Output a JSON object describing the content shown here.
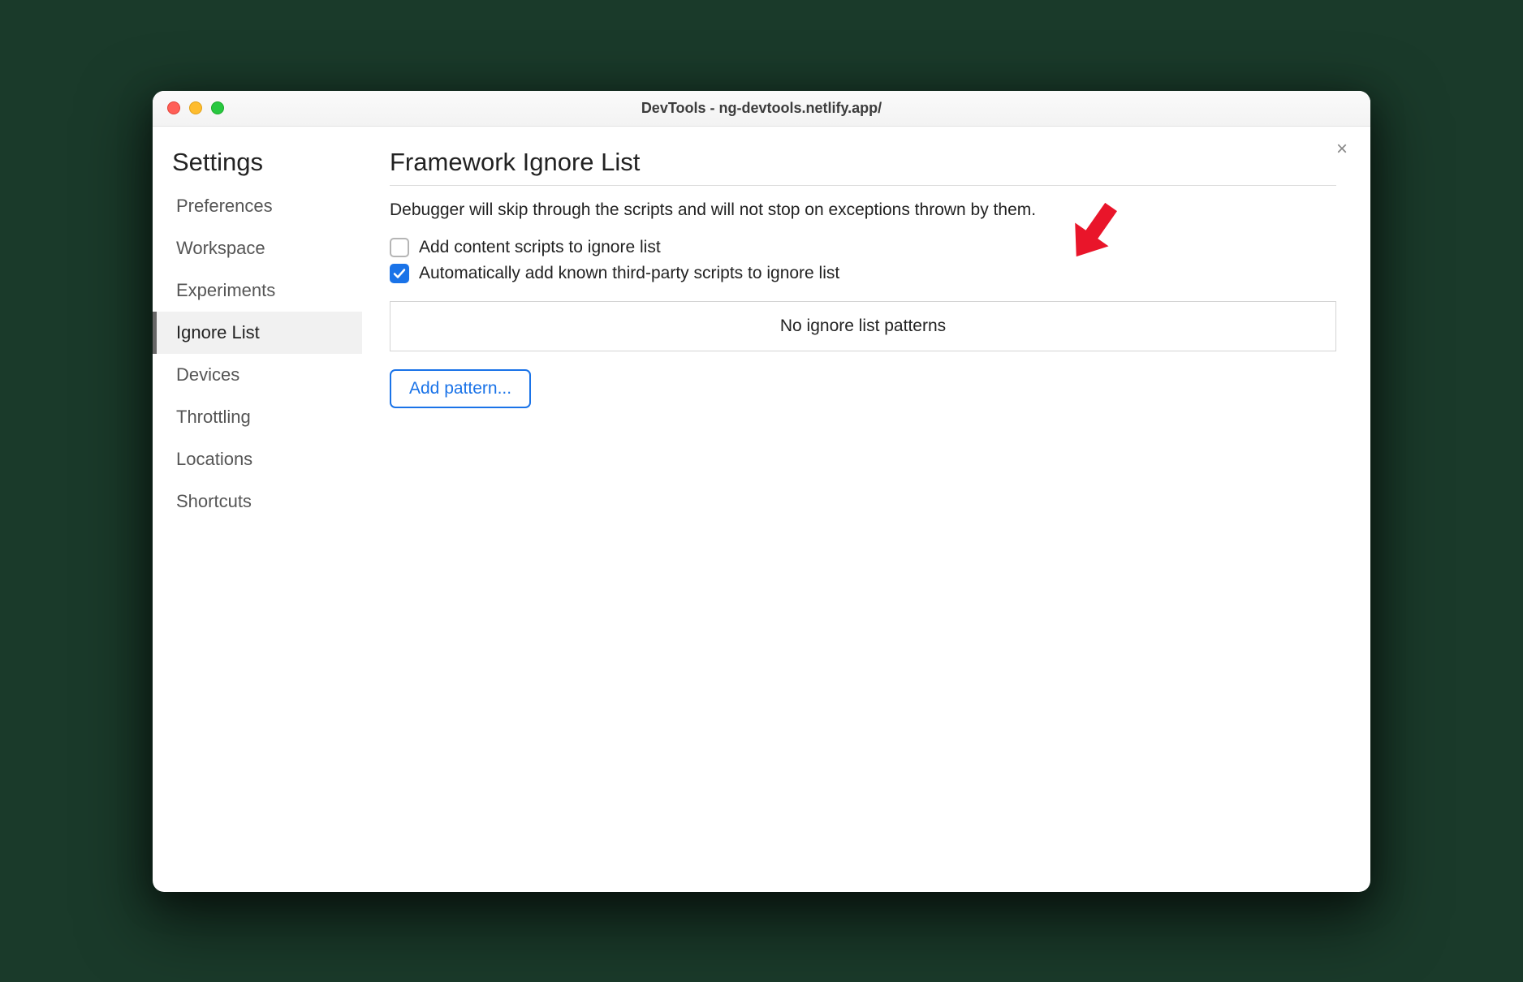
{
  "window": {
    "title": "DevTools - ng-devtools.netlify.app/"
  },
  "close_label": "×",
  "sidebar": {
    "heading": "Settings",
    "items": [
      {
        "label": "Preferences",
        "active": false
      },
      {
        "label": "Workspace",
        "active": false
      },
      {
        "label": "Experiments",
        "active": false
      },
      {
        "label": "Ignore List",
        "active": true
      },
      {
        "label": "Devices",
        "active": false
      },
      {
        "label": "Throttling",
        "active": false
      },
      {
        "label": "Locations",
        "active": false
      },
      {
        "label": "Shortcuts",
        "active": false
      }
    ]
  },
  "main": {
    "title": "Framework Ignore List",
    "description": "Debugger will skip through the scripts and will not stop on exceptions thrown by them.",
    "checkboxes": [
      {
        "label": "Add content scripts to ignore list",
        "checked": false
      },
      {
        "label": "Automatically add known third-party scripts to ignore list",
        "checked": true
      }
    ],
    "patterns_empty": "No ignore list patterns",
    "add_pattern_btn": "Add pattern..."
  }
}
